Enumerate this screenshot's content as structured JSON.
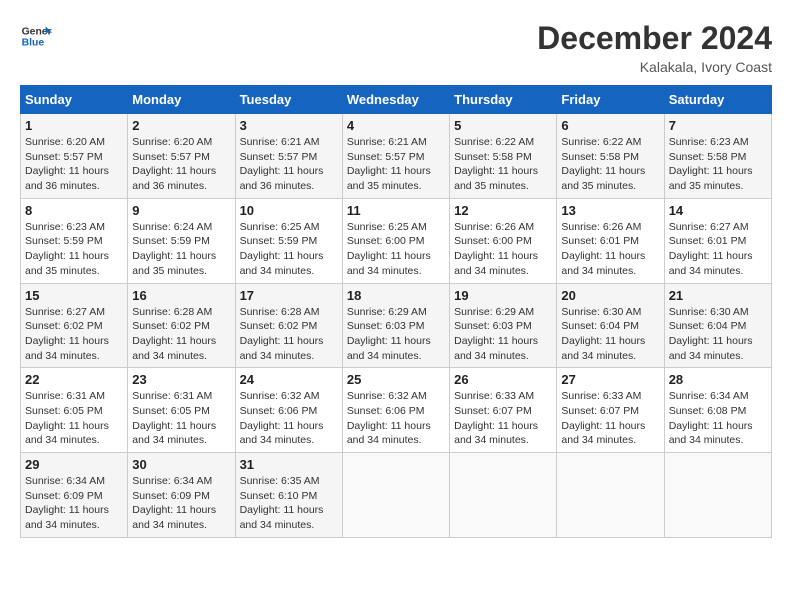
{
  "header": {
    "logo_line1": "General",
    "logo_line2": "Blue",
    "month_title": "December 2024",
    "location": "Kalakala, Ivory Coast"
  },
  "days_of_week": [
    "Sunday",
    "Monday",
    "Tuesday",
    "Wednesday",
    "Thursday",
    "Friday",
    "Saturday"
  ],
  "weeks": [
    [
      {
        "day": 1,
        "info": "Sunrise: 6:20 AM\nSunset: 5:57 PM\nDaylight: 11 hours\nand 36 minutes."
      },
      {
        "day": 2,
        "info": "Sunrise: 6:20 AM\nSunset: 5:57 PM\nDaylight: 11 hours\nand 36 minutes."
      },
      {
        "day": 3,
        "info": "Sunrise: 6:21 AM\nSunset: 5:57 PM\nDaylight: 11 hours\nand 36 minutes."
      },
      {
        "day": 4,
        "info": "Sunrise: 6:21 AM\nSunset: 5:57 PM\nDaylight: 11 hours\nand 35 minutes."
      },
      {
        "day": 5,
        "info": "Sunrise: 6:22 AM\nSunset: 5:58 PM\nDaylight: 11 hours\nand 35 minutes."
      },
      {
        "day": 6,
        "info": "Sunrise: 6:22 AM\nSunset: 5:58 PM\nDaylight: 11 hours\nand 35 minutes."
      },
      {
        "day": 7,
        "info": "Sunrise: 6:23 AM\nSunset: 5:58 PM\nDaylight: 11 hours\nand 35 minutes."
      }
    ],
    [
      {
        "day": 8,
        "info": "Sunrise: 6:23 AM\nSunset: 5:59 PM\nDaylight: 11 hours\nand 35 minutes."
      },
      {
        "day": 9,
        "info": "Sunrise: 6:24 AM\nSunset: 5:59 PM\nDaylight: 11 hours\nand 35 minutes."
      },
      {
        "day": 10,
        "info": "Sunrise: 6:25 AM\nSunset: 5:59 PM\nDaylight: 11 hours\nand 34 minutes."
      },
      {
        "day": 11,
        "info": "Sunrise: 6:25 AM\nSunset: 6:00 PM\nDaylight: 11 hours\nand 34 minutes."
      },
      {
        "day": 12,
        "info": "Sunrise: 6:26 AM\nSunset: 6:00 PM\nDaylight: 11 hours\nand 34 minutes."
      },
      {
        "day": 13,
        "info": "Sunrise: 6:26 AM\nSunset: 6:01 PM\nDaylight: 11 hours\nand 34 minutes."
      },
      {
        "day": 14,
        "info": "Sunrise: 6:27 AM\nSunset: 6:01 PM\nDaylight: 11 hours\nand 34 minutes."
      }
    ],
    [
      {
        "day": 15,
        "info": "Sunrise: 6:27 AM\nSunset: 6:02 PM\nDaylight: 11 hours\nand 34 minutes."
      },
      {
        "day": 16,
        "info": "Sunrise: 6:28 AM\nSunset: 6:02 PM\nDaylight: 11 hours\nand 34 minutes."
      },
      {
        "day": 17,
        "info": "Sunrise: 6:28 AM\nSunset: 6:02 PM\nDaylight: 11 hours\nand 34 minutes."
      },
      {
        "day": 18,
        "info": "Sunrise: 6:29 AM\nSunset: 6:03 PM\nDaylight: 11 hours\nand 34 minutes."
      },
      {
        "day": 19,
        "info": "Sunrise: 6:29 AM\nSunset: 6:03 PM\nDaylight: 11 hours\nand 34 minutes."
      },
      {
        "day": 20,
        "info": "Sunrise: 6:30 AM\nSunset: 6:04 PM\nDaylight: 11 hours\nand 34 minutes."
      },
      {
        "day": 21,
        "info": "Sunrise: 6:30 AM\nSunset: 6:04 PM\nDaylight: 11 hours\nand 34 minutes."
      }
    ],
    [
      {
        "day": 22,
        "info": "Sunrise: 6:31 AM\nSunset: 6:05 PM\nDaylight: 11 hours\nand 34 minutes."
      },
      {
        "day": 23,
        "info": "Sunrise: 6:31 AM\nSunset: 6:05 PM\nDaylight: 11 hours\nand 34 minutes."
      },
      {
        "day": 24,
        "info": "Sunrise: 6:32 AM\nSunset: 6:06 PM\nDaylight: 11 hours\nand 34 minutes."
      },
      {
        "day": 25,
        "info": "Sunrise: 6:32 AM\nSunset: 6:06 PM\nDaylight: 11 hours\nand 34 minutes."
      },
      {
        "day": 26,
        "info": "Sunrise: 6:33 AM\nSunset: 6:07 PM\nDaylight: 11 hours\nand 34 minutes."
      },
      {
        "day": 27,
        "info": "Sunrise: 6:33 AM\nSunset: 6:07 PM\nDaylight: 11 hours\nand 34 minutes."
      },
      {
        "day": 28,
        "info": "Sunrise: 6:34 AM\nSunset: 6:08 PM\nDaylight: 11 hours\nand 34 minutes."
      }
    ],
    [
      {
        "day": 29,
        "info": "Sunrise: 6:34 AM\nSunset: 6:09 PM\nDaylight: 11 hours\nand 34 minutes."
      },
      {
        "day": 30,
        "info": "Sunrise: 6:34 AM\nSunset: 6:09 PM\nDaylight: 11 hours\nand 34 minutes."
      },
      {
        "day": 31,
        "info": "Sunrise: 6:35 AM\nSunset: 6:10 PM\nDaylight: 11 hours\nand 34 minutes."
      },
      null,
      null,
      null,
      null
    ]
  ]
}
